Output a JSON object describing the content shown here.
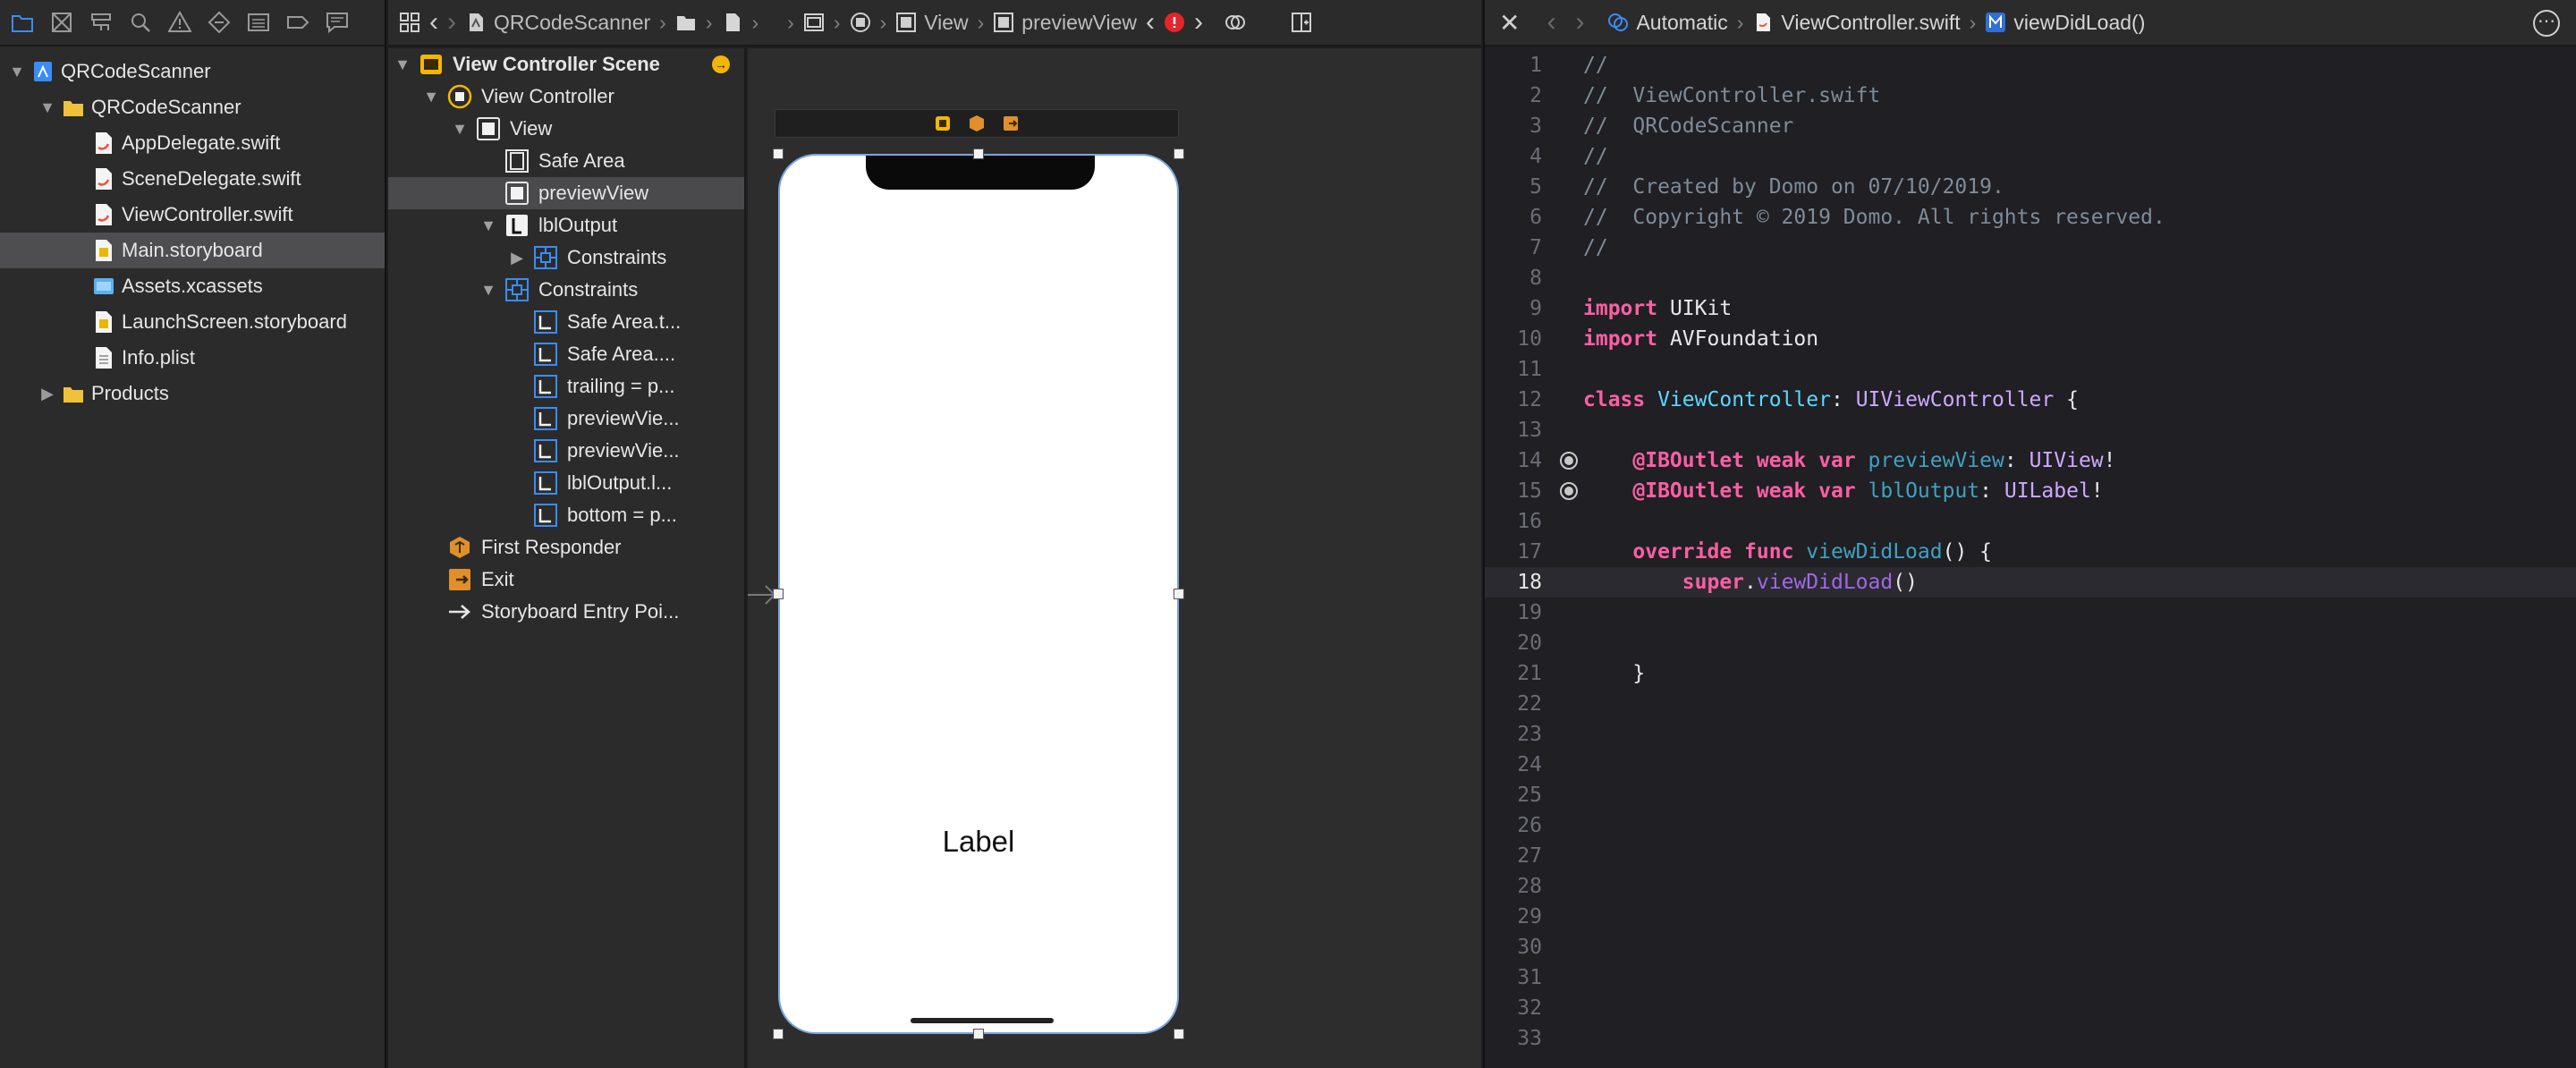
{
  "navigator": {
    "files": [
      {
        "label": "QRCodeScanner",
        "level": 0,
        "type": "project",
        "expanded": true
      },
      {
        "label": "QRCodeScanner",
        "level": 1,
        "type": "folder",
        "expanded": true
      },
      {
        "label": "AppDelegate.swift",
        "level": 2,
        "type": "swift"
      },
      {
        "label": "SceneDelegate.swift",
        "level": 2,
        "type": "swift"
      },
      {
        "label": "ViewController.swift",
        "level": 2,
        "type": "swift"
      },
      {
        "label": "Main.storyboard",
        "level": 2,
        "type": "storyboard",
        "selected": true
      },
      {
        "label": "Assets.xcassets",
        "level": 2,
        "type": "assets"
      },
      {
        "label": "LaunchScreen.storyboard",
        "level": 2,
        "type": "storyboard"
      },
      {
        "label": "Info.plist",
        "level": 2,
        "type": "plist"
      },
      {
        "label": "Products",
        "level": 1,
        "type": "folder",
        "expanded": false
      }
    ]
  },
  "ib": {
    "jump_bar": {
      "project": "QRCodeScanner",
      "view": "View",
      "preview_view": "previewView"
    },
    "outline": [
      {
        "label": "View Controller Scene",
        "level": 0,
        "icon": "scene-icon",
        "disc": "down",
        "bold": true
      },
      {
        "label": "View Controller",
        "level": 1,
        "icon": "view-controller-icon",
        "disc": "down"
      },
      {
        "label": "View",
        "level": 2,
        "icon": "view-icon",
        "disc": "down"
      },
      {
        "label": "Safe Area",
        "level": 3,
        "icon": "safe-area-icon"
      },
      {
        "label": "previewView",
        "level": 3,
        "icon": "view-icon",
        "selected": true
      },
      {
        "label": "lblOutput",
        "level": 3,
        "icon": "label-icon",
        "disc": "down"
      },
      {
        "label": "Constraints",
        "level": 4,
        "icon": "constraints-icon",
        "disc": "right"
      },
      {
        "label": "Constraints",
        "level": 3,
        "icon": "constraints-icon",
        "disc": "down"
      },
      {
        "label": "Safe Area.t...",
        "level": 4,
        "icon": "constraint-icon"
      },
      {
        "label": "Safe Area....",
        "level": 4,
        "icon": "constraint-icon"
      },
      {
        "label": "trailing = p...",
        "level": 4,
        "icon": "constraint-icon"
      },
      {
        "label": "previewVie...",
        "level": 4,
        "icon": "constraint-icon"
      },
      {
        "label": "previewVie...",
        "level": 4,
        "icon": "constraint-icon"
      },
      {
        "label": "lblOutput.l...",
        "level": 4,
        "icon": "constraint-icon"
      },
      {
        "label": "bottom = p...",
        "level": 4,
        "icon": "constraint-icon"
      },
      {
        "label": "First Responder",
        "level": 1,
        "icon": "first-responder-icon"
      },
      {
        "label": "Exit",
        "level": 1,
        "icon": "exit-icon"
      },
      {
        "label": "Storyboard Entry Poi...",
        "level": 1,
        "icon": "arrow-icon"
      }
    ],
    "canvas": {
      "label_text": "Label"
    }
  },
  "editor": {
    "jump_bar": {
      "mode": "Automatic",
      "file": "ViewController.swift",
      "method": "viewDidLoad()"
    },
    "current_line": 18,
    "lines": [
      {
        "n": 1,
        "tokens": [
          [
            "comment",
            "//"
          ]
        ]
      },
      {
        "n": 2,
        "tokens": [
          [
            "comment",
            "//  ViewController.swift"
          ]
        ]
      },
      {
        "n": 3,
        "tokens": [
          [
            "comment",
            "//  QRCodeScanner"
          ]
        ]
      },
      {
        "n": 4,
        "tokens": [
          [
            "comment",
            "//"
          ]
        ]
      },
      {
        "n": 5,
        "tokens": [
          [
            "comment",
            "//  Created by Domo on 07/10/2019."
          ]
        ]
      },
      {
        "n": 6,
        "tokens": [
          [
            "comment",
            "//  Copyright © 2019 Domo. All rights reserved."
          ]
        ]
      },
      {
        "n": 7,
        "tokens": [
          [
            "comment",
            "//"
          ]
        ]
      },
      {
        "n": 8,
        "tokens": []
      },
      {
        "n": 9,
        "tokens": [
          [
            "kw",
            "import"
          ],
          [
            "plain",
            " UIKit"
          ]
        ]
      },
      {
        "n": 10,
        "tokens": [
          [
            "kw",
            "import"
          ],
          [
            "plain",
            " AVFoundation"
          ]
        ]
      },
      {
        "n": 11,
        "tokens": []
      },
      {
        "n": 12,
        "tokens": [
          [
            "kw",
            "class"
          ],
          [
            "plain",
            " "
          ],
          [
            "type",
            "ViewController"
          ],
          [
            "plain",
            ": "
          ],
          [
            "sysType",
            "UIViewController"
          ],
          [
            "plain",
            " {"
          ]
        ]
      },
      {
        "n": 13,
        "tokens": []
      },
      {
        "n": 14,
        "outlet": true,
        "tokens": [
          [
            "plain",
            "    "
          ],
          [
            "kw",
            "@IBOutlet"
          ],
          [
            "plain",
            " "
          ],
          [
            "kw",
            "weak"
          ],
          [
            "plain",
            " "
          ],
          [
            "kw",
            "var"
          ],
          [
            "plain",
            " "
          ],
          [
            "prop",
            "previewView"
          ],
          [
            "plain",
            ": "
          ],
          [
            "sysType",
            "UIView"
          ],
          [
            "plain",
            "!"
          ]
        ]
      },
      {
        "n": 15,
        "outlet": true,
        "tokens": [
          [
            "plain",
            "    "
          ],
          [
            "kw",
            "@IBOutlet"
          ],
          [
            "plain",
            " "
          ],
          [
            "kw",
            "weak"
          ],
          [
            "plain",
            " "
          ],
          [
            "kw",
            "var"
          ],
          [
            "plain",
            " "
          ],
          [
            "prop",
            "lblOutput"
          ],
          [
            "plain",
            ": "
          ],
          [
            "sysType",
            "UILabel"
          ],
          [
            "plain",
            "!"
          ]
        ]
      },
      {
        "n": 16,
        "tokens": []
      },
      {
        "n": 17,
        "tokens": [
          [
            "plain",
            "    "
          ],
          [
            "kw",
            "override"
          ],
          [
            "plain",
            " "
          ],
          [
            "kw",
            "func"
          ],
          [
            "plain",
            " "
          ],
          [
            "prop",
            "viewDidLoad"
          ],
          [
            "plain",
            "() {"
          ]
        ]
      },
      {
        "n": 18,
        "tokens": [
          [
            "plain",
            "        "
          ],
          [
            "kw",
            "super"
          ],
          [
            "plain",
            "."
          ],
          [
            "func",
            "viewDidLoad"
          ],
          [
            "plain",
            "()"
          ]
        ]
      },
      {
        "n": 19,
        "tokens": []
      },
      {
        "n": 20,
        "tokens": []
      },
      {
        "n": 21,
        "tokens": [
          [
            "plain",
            "    }"
          ]
        ]
      },
      {
        "n": 22,
        "tokens": []
      },
      {
        "n": 23,
        "tokens": []
      },
      {
        "n": 24,
        "tokens": []
      },
      {
        "n": 25,
        "tokens": []
      },
      {
        "n": 26,
        "tokens": []
      },
      {
        "n": 27,
        "tokens": []
      },
      {
        "n": 28,
        "tokens": []
      },
      {
        "n": 29,
        "tokens": []
      },
      {
        "n": 30,
        "tokens": []
      },
      {
        "n": 31,
        "tokens": []
      },
      {
        "n": 32,
        "tokens": []
      },
      {
        "n": 33,
        "tokens": []
      }
    ]
  },
  "colors": {
    "accent": "#4a90e2",
    "folder": "#f0c23b",
    "error": "#e5252a",
    "warning": "#f2b705"
  }
}
